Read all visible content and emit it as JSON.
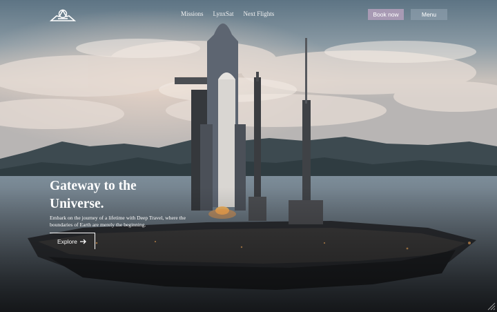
{
  "nav": {
    "logo_icon": "rocket-logo-icon",
    "links": [
      "Missions",
      "LynxSat",
      "Next Flights"
    ],
    "book_label": "Book now",
    "menu_label": "Menu"
  },
  "hero": {
    "title_line1": "Gateway to the",
    "title_line2": "Universe.",
    "subtitle": "Embark on the journey of a lifetime with Deep Travel, where the boundaries of Earth are merely the beginning.",
    "explore_label": "Explore",
    "explore_icon": "arrow-right-icon",
    "background": "rocket launch platform at sea with mountains and cloudy sky"
  },
  "colors": {
    "book_button": "#a89ab4",
    "menu_button": "#8a99aa",
    "text": "#ffffff"
  }
}
